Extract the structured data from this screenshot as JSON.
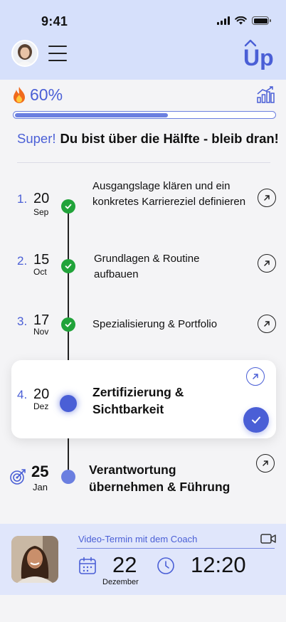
{
  "status_bar": {
    "time": "9:41"
  },
  "header": {
    "logo_text": "Up",
    "menu_icon": "hamburger-icon"
  },
  "progress": {
    "percent_label": "60%",
    "percent_value": 60,
    "fill_fraction": 0.59,
    "icon": "fire-icon"
  },
  "motivation": {
    "highlight": "Super!",
    "text": "Du bist über die Hälfte - bleib dran!"
  },
  "steps": [
    {
      "number": "1.",
      "day": "20",
      "month": "Sep",
      "title": "Ausgangslage klären und ein konkretes Karriereziel definieren",
      "status": "done"
    },
    {
      "number": "2.",
      "day": "15",
      "month": "Oct",
      "title": "Grundlagen & Routine aufbauen",
      "status": "done"
    },
    {
      "number": "3.",
      "day": "17",
      "month": "Nov",
      "title": "Spezialisierung & Portfolio",
      "status": "done"
    },
    {
      "number": "4.",
      "day": "20",
      "month": "Dez",
      "title": "Zertifizierung & Sichtbarkeit",
      "status": "active"
    },
    {
      "number": "",
      "day": "25",
      "month": "Jan",
      "title": "Verantwortung übernehmen & Führung",
      "status": "goal"
    }
  ],
  "coach": {
    "title": "Video-Termin mit dem Coach",
    "day": "22",
    "month": "Dezember",
    "time": "12:20"
  },
  "colors": {
    "accent": "#4a5fd6",
    "accent_light": "#6b7fe0",
    "done": "#21a33a",
    "header_bg": "#d6e0fb",
    "panel_bg": "#e0e6fb"
  }
}
